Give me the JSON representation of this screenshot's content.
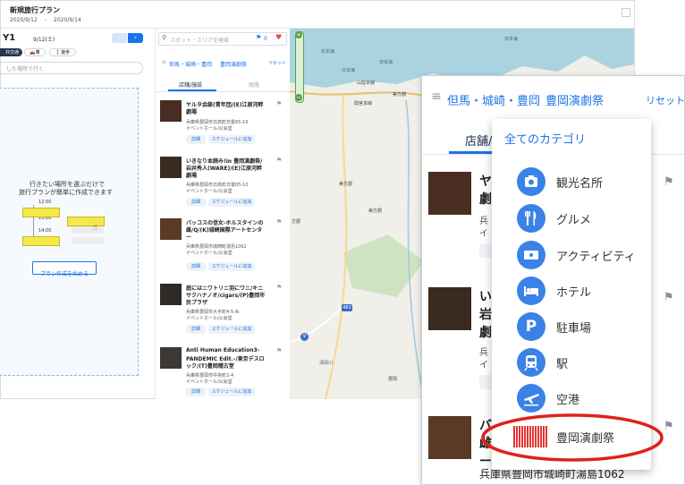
{
  "trip": {
    "title": "新規旅行プラン",
    "start_date": "2020/9/12",
    "date_sep": "-",
    "end_date": "2020/9/14",
    "day_label": "Y1",
    "day_date": "9/12(土)",
    "mode_public": "共交通",
    "mode_car": "車",
    "mode_walk": "徒歩",
    "search_placeholder": "した場所で行く",
    "prompt_line1": "行きたい場所を選ぶだけで",
    "prompt_line2": "旅行プランが簡単に作成できます",
    "times": [
      "12:00",
      "13:00",
      "14:00"
    ],
    "create_button": "プラン作成を始める"
  },
  "spot_search": {
    "placeholder": "スポット・エリアを検索",
    "flag_count": "0",
    "filter_area": "但馬・城崎・豊岡",
    "filter_category": "豊岡演劇祭",
    "reset": "リセット",
    "tab_shops": "店舗/施設",
    "tab_routes": "経路"
  },
  "spots": [
    {
      "title_line1": "ヤルタ会談(青年団/(E)江原河畔",
      "title_line2": "劇場",
      "address": "兵庫県豊岡市日高町日置65-10",
      "category": "イベントホール/公会堂",
      "photo": "#4a2d22"
    },
    {
      "title_line1": "いきなり本読み!in 豊岡演劇祭/",
      "title_line2": "岩井秀人(WARE)/(E)江原河畔",
      "title_line3": "劇場",
      "address": "兵庫県豊岡市日高町日置65-10",
      "category": "イベントホール/公会堂",
      "photo": "#3a2a20"
    },
    {
      "title_line1": "バッコスの信女-ホルスタインの",
      "title_line2": "雌/Q/(K)城崎国際アートセンタ",
      "title_line3": "ー",
      "address": "兵庫県豊岡市城崎町湯島1062",
      "category": "イベントホール/公会堂",
      "photo": "#5a3a24"
    },
    {
      "title_line1": "庭にはニワトリニ羽にワニ/キニ",
      "title_line2": "サクハナノオ/cigars/(P)豊岡市",
      "title_line3": "民プラザ",
      "address": "兵庫県豊岡市大手町4-5 Ai",
      "category": "イベントホール/公会堂",
      "photo": "#2e2a26"
    },
    {
      "title_line1": "Anti Human Education3-",
      "title_line2": "PANDEMIC Edit.-/東京デスロ",
      "title_line3": "ック/(T)豊岡稽古堂",
      "address": "兵庫県豊岡市中央町2-4",
      "category": "イベントホール/公会堂",
      "photo": "#3c3834"
    }
  ],
  "spot_buttons": {
    "detail": "詳細",
    "add_schedule": "スケジュールに追加"
  },
  "map_labels": {
    "sea1": "日本海",
    "sea2": "日本海",
    "sea3": "日本海",
    "sea4": "日本海",
    "town1": "山陰本線",
    "town2": "関宮本線",
    "town3": "美方郡",
    "town4": "美方郡",
    "town5": "美方郡",
    "town6": "方郡",
    "town7": "豊岡",
    "town8": "湯岡川",
    "road1": "9",
    "road2": "482"
  },
  "zoom": {
    "filter_area": "但馬・城崎・豊岡",
    "filter_category": "豊岡演劇祭",
    "reset": "リセット",
    "tab_shops": "店舗/施",
    "all_categories": "全てのカテゴリ",
    "categories": [
      {
        "label": "観光名所",
        "icon": "camera-icon"
      },
      {
        "label": "グルメ",
        "icon": "fork-knife-icon"
      },
      {
        "label": "アクティビティ",
        "icon": "ticket-icon"
      },
      {
        "label": "ホテル",
        "icon": "bed-icon"
      },
      {
        "label": "駐車場",
        "icon": "parking-icon"
      },
      {
        "label": "駅",
        "icon": "train-icon"
      },
      {
        "label": "空港",
        "icon": "airplane-icon"
      },
      {
        "label": "豊岡演劇祭",
        "icon": "festival-logo-icon"
      }
    ],
    "peek_rows": [
      {
        "line1": "ヤ",
        "line2": "劇",
        "line3": "兵",
        "line4": "イ"
      },
      {
        "line1": "い",
        "line2": "岩",
        "line3": "劇",
        "line4": "兵",
        "line5": "イ"
      },
      {
        "line1": "バ",
        "line2": "雌",
        "line3": "ー"
      }
    ],
    "bottom_address": "兵庫県豊岡市城崎町湯島1062",
    "highlight_color": "#e0201b",
    "accent_color": "#1a73e8"
  }
}
